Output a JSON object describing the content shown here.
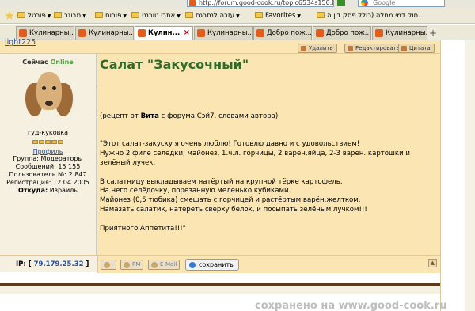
{
  "browser": {
    "address": "http://forum.good-cook.ru/topic6534s150.html",
    "search_placeholder": "Google",
    "bookmarks": [
      {
        "label": "פורטל"
      },
      {
        "label": "מבוגר"
      },
      {
        "label": "פורום"
      },
      {
        "label": "אתרי טורנט"
      },
      {
        "label": "עזרה לנתרגם"
      },
      {
        "label": "Favorites"
      },
      {
        "label": "חוק דמי מחלה (כולל פסק דין ה..."
      }
    ],
    "tabs": [
      {
        "label": "Кулинарны..."
      },
      {
        "label": "Кулинарны..."
      },
      {
        "label": "Кулин..."
      },
      {
        "label": "Кулинарны..."
      },
      {
        "label": "Добро пож..."
      },
      {
        "label": "Добро пож..."
      },
      {
        "label": "Кулинарны..."
      }
    ],
    "new_tab_label": "+"
  },
  "post": {
    "author_link": "light225",
    "buttons": {
      "delete": "Удалить",
      "edit": "Редактировать",
      "quote": "Цитата"
    },
    "title": "Салат \"Закусочный\"",
    "dot": ".",
    "body": {
      "intro_prefix": "(рецепт от ",
      "intro_author": "Вита",
      "intro_suffix": " с форума Сэй7, словами автора)",
      "lines_1": [
        "\"Этот салат-закуску я очень люблю! Готовлю давно и с удовольствием!",
        "Нужно 2 филе селёдки, майонез, 1.ч.л. горчицы, 2 варен.яйца, 2-3 варен. картошки и",
        "зелёный лучек."
      ],
      "lines_2": [
        "В салатницу выкладываем натёртый на крупной тёрке картофель.",
        "На него селёдочку, порезанную меленько кубиками.",
        "Майонез (0,5 тюбика) смешать с горчицей и растёртым варён.желтком.",
        "Намазать салатик, натереть сверху белок, и посыпать зелёным лучком!!!"
      ],
      "closing": "Приятного Аппетита!!!\""
    }
  },
  "user": {
    "status_label": "Сейчас",
    "status_value": "Online",
    "nick": "гуд-куковка",
    "profile_label": "Профиль",
    "info": [
      {
        "label": "Группа:",
        "value": "Модераторы"
      },
      {
        "label": "Сообщений:",
        "value": "15 155"
      },
      {
        "label": "Пользователь №:",
        "value": "2 847"
      },
      {
        "label": "Регистрация:",
        "value": "12.04.2005"
      },
      {
        "label": "Откуда:",
        "value": "Израиль"
      }
    ]
  },
  "footer": {
    "ip_label": "IP:",
    "ip_value": "79.179.25.32",
    "pm_label": "PM",
    "email_label": "E-Mail",
    "save_label": "сохранить",
    "up_label": "▲"
  },
  "watermark": "сохранено на www.good-cook.ru",
  "colors": {
    "post_bg": "#fbe5b3",
    "title_green": "#2f6b2a",
    "link_blue": "#2a4f9b",
    "online_green": "#47a844"
  }
}
